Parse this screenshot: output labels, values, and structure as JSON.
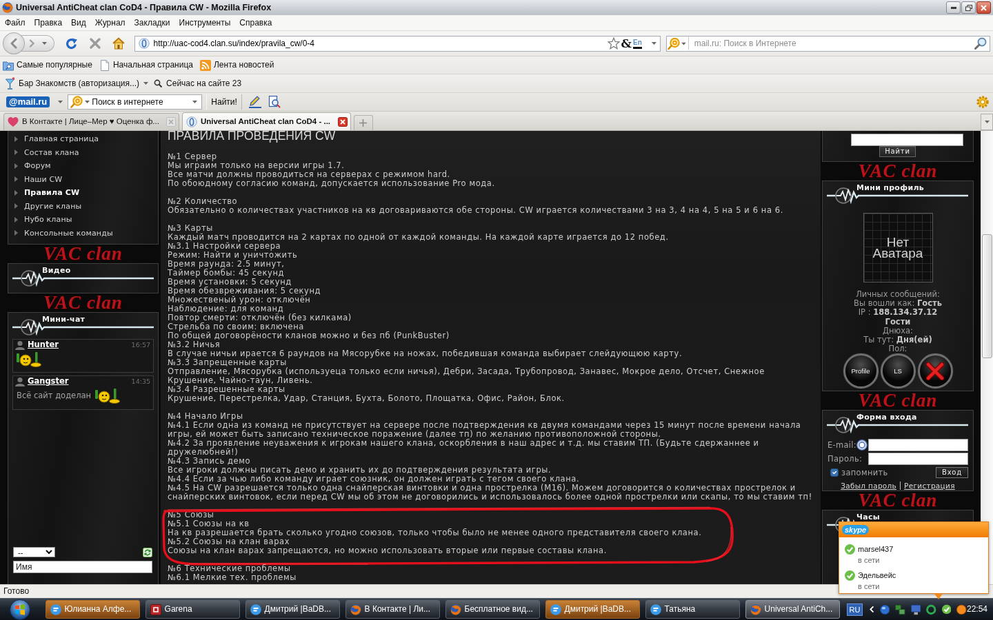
{
  "window": {
    "title": "Universal AntiCheat clan CoD4 - Правила CW - Mozilla Firefox"
  },
  "menu": [
    "Файл",
    "Правка",
    "Вид",
    "Журнал",
    "Закладки",
    "Инструменты",
    "Справка"
  ],
  "address_bar": {
    "url": "http://uac-cod4.clan.su/index/pravila_cw/0-4",
    "addon_glyph": "&",
    "language_badge": "En"
  },
  "search_bar": {
    "placeholder": "mail.ru: Поиск в Интернете"
  },
  "bookmarks": [
    {
      "kind": "smart",
      "label": "Самые популярные"
    },
    {
      "kind": "page",
      "label": "Начальная страница"
    },
    {
      "kind": "feed",
      "label": "Лента новостей"
    }
  ],
  "dating_toolbar": {
    "menu": "Бар Знакомств (авторизация...)",
    "online": "Сейчас на сайте 23"
  },
  "mail_toolbar": {
    "logo": "@mail.ru",
    "search": "Поиск в интернете",
    "button": "Найти!"
  },
  "tabs": [
    {
      "label": "В Контакте | Лице–Мер ♥ Оценка ф...",
      "selected": false
    },
    {
      "label": "Universal AntiCheat clan CoD4 - ...",
      "selected": true
    }
  ],
  "left_sidebar": {
    "menu": [
      {
        "label": "Главная страница",
        "selected": false
      },
      {
        "label": "Состав клана",
        "selected": false
      },
      {
        "label": "Форум",
        "selected": false
      },
      {
        "label": "Наши CW",
        "selected": false
      },
      {
        "label": "Правила CW",
        "selected": true
      },
      {
        "label": "Другие кланы",
        "selected": false
      },
      {
        "label": "Нубо кланы",
        "selected": false
      },
      {
        "label": "Консольные команды",
        "selected": false
      }
    ],
    "video": {
      "logo": "VAC clan",
      "title": "Видео"
    },
    "chat": {
      "logo": "VAC clan",
      "title": "Мини-чат",
      "messages": [
        {
          "author": "Hunter",
          "time": "16:57"
        },
        {
          "author": "Gangster",
          "time": "14:35",
          "text": "Всё сайт доделан"
        }
      ],
      "filter": "--",
      "name_field": "Имя"
    }
  },
  "content": {
    "heading": "ПРАВИЛА ПРОВЕДЕНИЯ CW",
    "sections": [
      {
        "circled": false,
        "lines": [
          "№1 Сервер",
          "Мы играим только на версии игры 1.7.",
          "Все матчи должны проводиться на серверах с режимом hard.",
          "По обоюдному согласию команд, допускается использование Pro мода."
        ]
      },
      {
        "circled": false,
        "lines": [
          "№2 Количество",
          "Обязательно о количествах участников на кв договариваются обе стороны. CW играется количествами 3 на 3, 4 на 4, 5 на 5 и 6 на 6."
        ]
      },
      {
        "circled": false,
        "lines": [
          "№3 Карты",
          "Каждый матч проводится на 2 картах по одной от каждой команды. На каждой карте играется до 12 побед.",
          "№3.1 Настройки сервера",
          "Режим: Найти и уничтожить",
          "Время раунда: 2.5 минут,",
          "Таймер бомбы: 45 секунд",
          "Время установки: 5 секунд",
          "Время обезвреживания: 5 секунд",
          "Множественый урон: отключён",
          "Наблюдение: для команд",
          "Повтор смерти: отключён (без килкама)",
          "Стрельба по своим: включена",
          "По общей договорёности кланов можно и без пб (PunkBuster)",
          "№3.2 Ничья",
          "В случае ничьи ирается 6 раундов на Мясорубке на ножах, победившая команда выбирает слейдующюю карту.",
          "№3.3 Запрещенные карты",
          "Отправление, Мясорубка (используеца только если ничья), Дебри, Засада, Трубопровод, Занавес, Мокрое дело, Отсчет, Снежное Крушение, Чайно-таун, Ливень.",
          "№3.4 Разрешенные карты",
          "Крушение, Перестрелка, Удар, Станция, Бухта, Болото, Площатка, Офис, Район, Блок."
        ]
      },
      {
        "circled": false,
        "lines": [
          "№4 Начало Игры",
          "№4.1 Если одна из команд не присутствует на сервере после подтверждения кв двумя командами через 15 минут после времени начала игры, ей может быть записано техническое поражение (далее тп) по желанию противоположной стороны.",
          "№4.2 За проявление неуважения к игрокам нашего клана, оскорбления в наш адрес и т.д. мы ставим ТП. (Будьте сдержаннее и дружелюбней!)",
          "№4.3 Запись демо",
          "Все игроки должны писать демо и хранить их до подтверждения результата игры.",
          "№4.4 Если за чью либо команду играет союзник, он должен играть с тегом своего клана.",
          "№4.5 На CW разрешается только одна снайперская винтовки и одна прострелка (M16). Можем договорится о количествах прострелок и снайперских винтовок, если перед CW мы об этом не договорились и использовалось более одной прострелки или скапы, то мы ставим тп!"
        ]
      },
      {
        "circled": true,
        "lines": [
          "№5 Союзы",
          "№5.1 Союзы на кв",
          "На кв разрешается брать сколько угодно союзов, только чтобы было не менее одного представителя своего клана.",
          "№5.2 Союзы на клан варах",
          "Союзы на клан варах запрещаются, но можно использовать вторые или первые составы клана."
        ]
      },
      {
        "circled": false,
        "lines": [
          "№6 Технические проблемы",
          "№6.1 Мелкие тех. проблемы"
        ]
      }
    ]
  },
  "right_sidebar": {
    "search": {
      "button": "Найти"
    },
    "profile": {
      "logo": "VAC clan",
      "title": "Мини профиль",
      "avatar_text": "Нет Аватара",
      "lines": [
        {
          "kind": "plain",
          "text": "Личных сообщений:"
        },
        {
          "kind": "plain",
          "text": "Вы вошли как: **Гость**"
        },
        {
          "kind": "plain",
          "text": "IP : **188.134.37.12**"
        },
        {
          "kind": "value",
          "text": "Гости"
        },
        {
          "kind": "plain",
          "text": "Днюха:"
        },
        {
          "kind": "plain",
          "text": "Ты тут: **Дня(ей)**"
        },
        {
          "kind": "plain",
          "text": "Пол:"
        }
      ],
      "buttons": [
        {
          "kind": "label",
          "label": "Profile"
        },
        {
          "kind": "label",
          "label": "LS"
        },
        {
          "kind": "close"
        }
      ]
    },
    "login": {
      "logo": "VAC clan",
      "title": "Форма входа",
      "fields": [
        {
          "kind": "email",
          "label": "E-mail:"
        },
        {
          "kind": "password",
          "label": "Пароль:"
        }
      ],
      "remember": {
        "label": "запомнить",
        "checked": true
      },
      "submit": "Вход",
      "links": [
        "Забыл пароль",
        "Регистрация"
      ]
    },
    "clock": {
      "logo": "VAC clan",
      "title": "Часы"
    }
  },
  "status_bar": {
    "text": "Готово"
  },
  "skype_popup": {
    "logo": "skype",
    "contacts": [
      {
        "name": "marsel437",
        "status": "в сети"
      },
      {
        "name": "Эдельвейс",
        "status": "в сети"
      }
    ]
  },
  "taskbar": {
    "buttons": [
      {
        "kind": "chat",
        "label": "Юлианна Алфе...",
        "selected": false,
        "flashing": true
      },
      {
        "kind": "game",
        "label": "Garena",
        "selected": false,
        "flashing": false
      },
      {
        "kind": "chat",
        "label": "Дмитрий |BaDB...",
        "selected": false,
        "flashing": false
      },
      {
        "kind": "browser",
        "label": "В Контакте | Ли...",
        "selected": false,
        "flashing": false
      },
      {
        "kind": "browser",
        "label": "Бесплатное вид...",
        "selected": false,
        "flashing": false
      },
      {
        "kind": "chat",
        "label": "Дмитрий |BaDB...",
        "selected": false,
        "flashing": true
      },
      {
        "kind": "chat",
        "label": "Татьяна",
        "selected": false,
        "flashing": false
      },
      {
        "kind": "browser",
        "label": "Universal AntiCh...",
        "selected": true,
        "flashing": false
      }
    ],
    "language": "RU",
    "clock": "22:54"
  }
}
